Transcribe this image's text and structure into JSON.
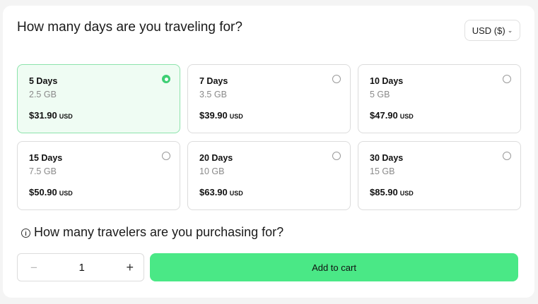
{
  "header": {
    "title": "How many days are you traveling for?",
    "currency_label": "USD ($)",
    "currency_icon": "chevron-down-icon"
  },
  "plans": [
    {
      "days": "5 Days",
      "data": "2.5 GB",
      "price": "$31.90",
      "unit": "USD",
      "selected": true
    },
    {
      "days": "7 Days",
      "data": "3.5 GB",
      "price": "$39.90",
      "unit": "USD",
      "selected": false
    },
    {
      "days": "10 Days",
      "data": "5 GB",
      "price": "$47.90",
      "unit": "USD",
      "selected": false
    },
    {
      "days": "15 Days",
      "data": "7.5 GB",
      "price": "$50.90",
      "unit": "USD",
      "selected": false
    },
    {
      "days": "20 Days",
      "data": "10 GB",
      "price": "$63.90",
      "unit": "USD",
      "selected": false
    },
    {
      "days": "30 Days",
      "data": "15 GB",
      "price": "$85.90",
      "unit": "USD",
      "selected": false
    }
  ],
  "travelers": {
    "title": "How many travelers are you purchasing for?",
    "info_icon": "info-icon",
    "quantity": "1",
    "minus": "−",
    "plus": "+"
  },
  "cart": {
    "label": "Add to cart"
  },
  "colors": {
    "accent": "#4ae886",
    "selected_bg": "#effcf3",
    "selected_border": "#8ce3ab"
  }
}
